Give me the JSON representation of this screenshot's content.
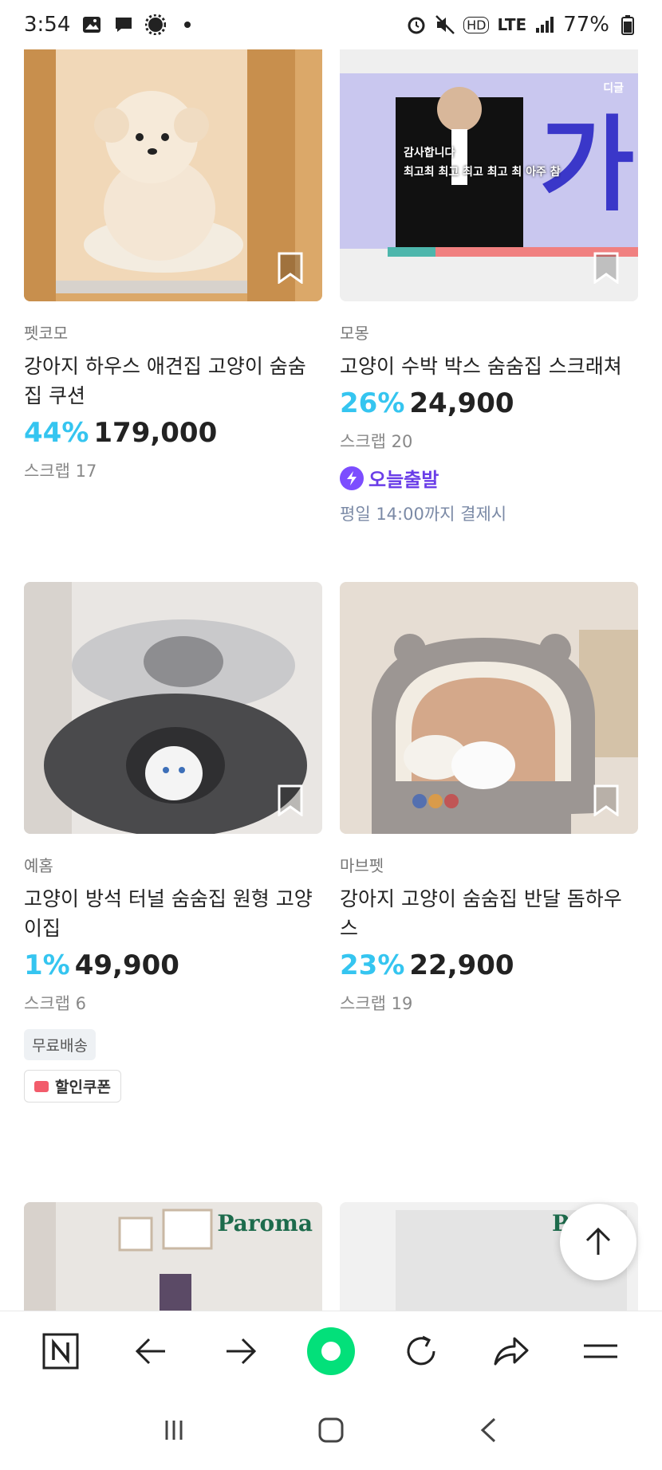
{
  "status_bar": {
    "time": "3:54",
    "network": "LTE",
    "hd": "HD",
    "battery": "77%"
  },
  "products": [
    {
      "seller": "펫코모",
      "title": "강아지 하우스 애견집 고양이 숨숨집 쿠션",
      "discount": "44%",
      "price": "179,000",
      "scrap": "스크랩 17"
    },
    {
      "seller": "모몽",
      "title": "고양이 수박 박스 숨숨집 스크래쳐",
      "discount": "26%",
      "price": "24,900",
      "scrap": "스크랩 20",
      "badge": "오늘출발",
      "badge_sub": "평일 14:00까지 결제시",
      "video_caption_1": "감사합니다",
      "video_caption_2": "최고최 최고 최고 최고 최 아주 참",
      "video_corner": "디글"
    },
    {
      "seller": "예홈",
      "title": "고양이 방석 터널 숨숨집 원형 고양이집",
      "discount": "1%",
      "price": "49,900",
      "scrap": "스크랩 6",
      "tag_free": "무료배송",
      "tag_coupon": "할인쿠폰"
    },
    {
      "seller": "마브펫",
      "title": "강아지 고양이 숨숨집 반달 돔하우스",
      "discount": "23%",
      "price": "22,900",
      "scrap": "스크랩 19"
    },
    {
      "brand_overlay": "Paroma"
    },
    {
      "brand_overlay": "P"
    }
  ],
  "colors": {
    "discount": "#35c5f0",
    "today_badge": "#7c4dff",
    "naver_green": "#03e07a"
  },
  "icons": {
    "browser_bar": [
      "naver-n-icon",
      "back-arrow-icon",
      "forward-arrow-icon",
      "naver-green-dot-icon",
      "refresh-icon",
      "share-icon",
      "menu-icon"
    ],
    "nav_bar": [
      "recent-apps-icon",
      "home-icon",
      "back-icon"
    ]
  }
}
